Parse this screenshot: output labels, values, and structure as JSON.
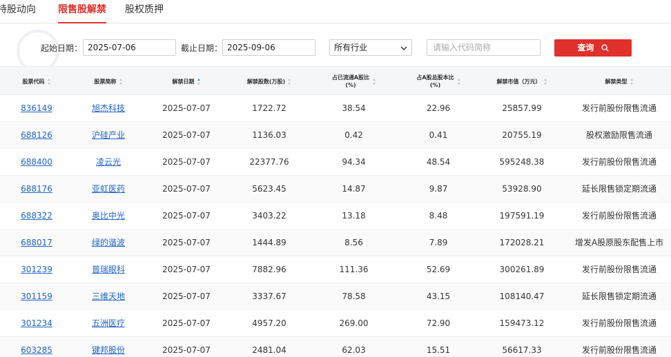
{
  "tabs": [
    {
      "label": "持股动向",
      "active": false
    },
    {
      "label": "限售股解禁",
      "active": true
    },
    {
      "label": "股权质押",
      "active": false
    }
  ],
  "filter": {
    "start_label": "起始日期：",
    "start_value": "2025-07-06",
    "end_label": "截止日期：",
    "end_value": "2025-09-06",
    "industry_value": "所有行业",
    "search_placeholder": "请输入代码简称",
    "query_label": "查询"
  },
  "table": {
    "headers": [
      {
        "label": "股票代码",
        "sort": "none"
      },
      {
        "label": "股票简称",
        "sort": "none"
      },
      {
        "label": "解禁日期",
        "sort": "asc"
      },
      {
        "label": "解禁股数(万股)",
        "sort": "none"
      },
      {
        "label": "占已流通A股比(%)",
        "sort": "none"
      },
      {
        "label": "占A股总股本比(%)",
        "sort": "none"
      },
      {
        "label": "解禁市值（万元）",
        "sort": "none"
      },
      {
        "label": "解禁类型",
        "sort": "none"
      }
    ],
    "rows": [
      {
        "code": "836149",
        "name": "旭杰科技",
        "date": "2025-07-07",
        "shares": "1722.72",
        "float_pct": "38.54",
        "total_pct": "22.96",
        "value": "25857.99",
        "type": "发行前股份限售流通"
      },
      {
        "code": "688126",
        "name": "沪硅产业",
        "date": "2025-07-07",
        "shares": "1136.03",
        "float_pct": "0.42",
        "total_pct": "0.41",
        "value": "20755.19",
        "type": "股权激励限售流通"
      },
      {
        "code": "688400",
        "name": "凌云光",
        "date": "2025-07-07",
        "shares": "22377.76",
        "float_pct": "94.34",
        "total_pct": "48.54",
        "value": "595248.38",
        "type": "发行前股份限售流通"
      },
      {
        "code": "688176",
        "name": "亚虹医药",
        "date": "2025-07-07",
        "shares": "5623.45",
        "float_pct": "14.87",
        "total_pct": "9.87",
        "value": "53928.90",
        "type": "延长限售锁定期流通"
      },
      {
        "code": "688322",
        "name": "奥比中光",
        "date": "2025-07-07",
        "shares": "3403.22",
        "float_pct": "13.18",
        "total_pct": "8.48",
        "value": "197591.19",
        "type": "发行前股份限售流通"
      },
      {
        "code": "688017",
        "name": "绿的谐波",
        "date": "2025-07-07",
        "shares": "1444.89",
        "float_pct": "8.56",
        "total_pct": "7.89",
        "value": "172028.21",
        "type": "增发A股原股东配售上市"
      },
      {
        "code": "301239",
        "name": "普瑞眼科",
        "date": "2025-07-07",
        "shares": "7882.96",
        "float_pct": "111.36",
        "total_pct": "52.69",
        "value": "300261.89",
        "type": "发行前股份限售流通"
      },
      {
        "code": "301159",
        "name": "三维天地",
        "date": "2025-07-07",
        "shares": "3337.67",
        "float_pct": "78.58",
        "total_pct": "43.15",
        "value": "108140.47",
        "type": "延长限售锁定期流通"
      },
      {
        "code": "301234",
        "name": "五洲医疗",
        "date": "2025-07-07",
        "shares": "4957.20",
        "float_pct": "269.00",
        "total_pct": "72.90",
        "value": "159473.12",
        "type": "发行前股份限售流通"
      },
      {
        "code": "603285",
        "name": "键邦股份",
        "date": "2025-07-07",
        "shares": "2481.04",
        "float_pct": "62.03",
        "total_pct": "15.51",
        "value": "56617.33",
        "type": "发行前股份限售流通"
      }
    ]
  },
  "colors": {
    "accent": "#e0302b",
    "link": "#1e64c8",
    "header_bg": "#f5f6f8"
  }
}
